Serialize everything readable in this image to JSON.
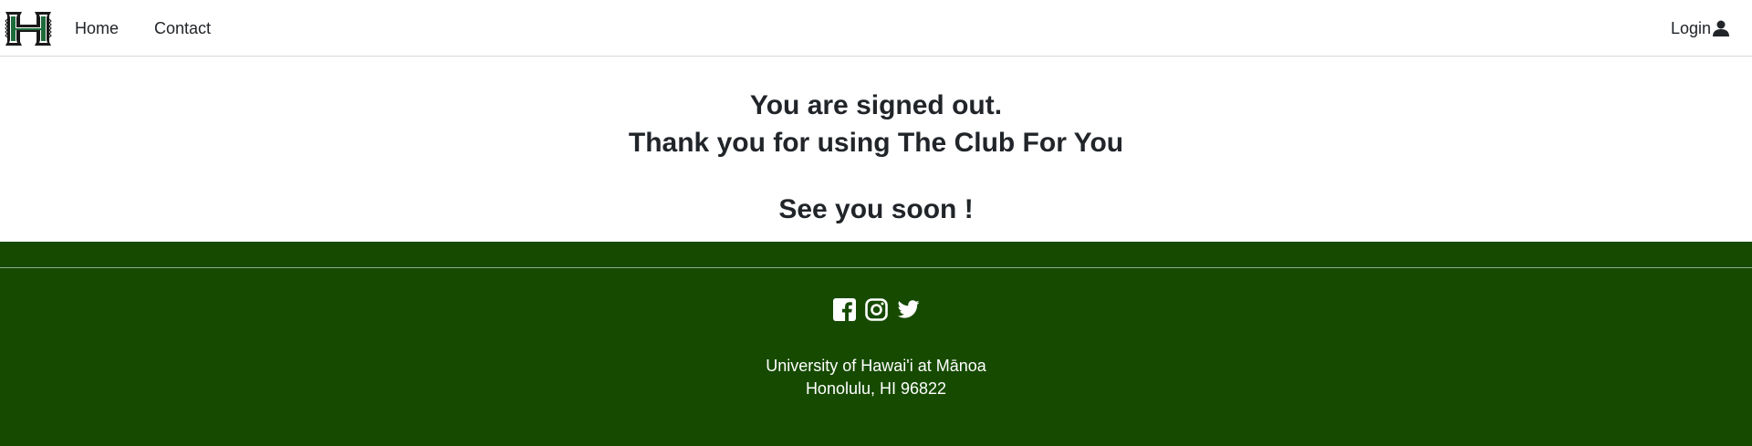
{
  "nav": {
    "logo_icon": "university-h-logo-icon",
    "home_label": "Home",
    "contact_label": "Contact",
    "login_label": "Login",
    "login_icon": "user-icon"
  },
  "main": {
    "line1": "You are signed out.",
    "line2": "Thank you for using The Club For You",
    "line3": "See you soon !"
  },
  "footer": {
    "social_icons": [
      "facebook-icon",
      "instagram-icon",
      "twitter-icon"
    ],
    "address_line1": "University of Hawai'i at Mānoa",
    "address_line2": "Honolulu, HI 96822"
  },
  "colors": {
    "footer_bg": "#164a00",
    "logo_green": "#1e6b3a",
    "text": "#212529"
  }
}
